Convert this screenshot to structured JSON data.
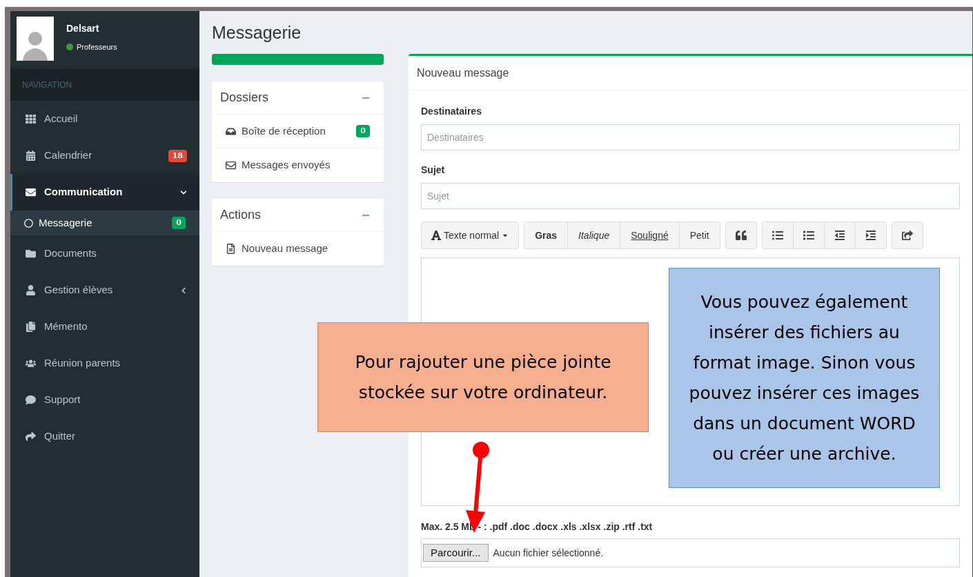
{
  "user": {
    "name": "Delsart",
    "role": "Professeurs",
    "online": true
  },
  "navigation": {
    "heading": "NAVIGATION",
    "items": [
      {
        "label": "Accueil",
        "kind": "grid",
        "selected": false
      },
      {
        "label": "Calendrier",
        "kind": "calendar",
        "selected": false,
        "badge": "18",
        "color": "#dd4b39"
      },
      {
        "label": "Communication",
        "kind": "envelope",
        "selected": true,
        "expanded": true,
        "children": [
          {
            "label": "Messagerie",
            "selected": true,
            "badge": "0",
            "color": "#00a65a"
          }
        ]
      },
      {
        "label": "Documents",
        "kind": "folder",
        "selected": false
      },
      {
        "label": "Gestion élèves",
        "kind": "user",
        "selected": false,
        "expanded": false
      },
      {
        "label": "Mémento",
        "kind": "copy",
        "selected": false
      },
      {
        "label": "Réunion parents",
        "kind": "users",
        "selected": false
      },
      {
        "label": "Support",
        "kind": "comment",
        "selected": false
      },
      {
        "label": "Quitter",
        "kind": "share",
        "selected": false
      }
    ]
  },
  "page_title": "Messagerie",
  "progress": {
    "level": 1
  },
  "folders": {
    "title": "Dossiers",
    "items": [
      {
        "label": "Boîte de réception",
        "kind": "inbox",
        "badge": "0",
        "color": "#00a65a"
      },
      {
        "label": "Messages envoyés",
        "kind": "envelope-outline"
      }
    ]
  },
  "actions": {
    "title": "Actions",
    "items": [
      {
        "label": "Nouveau message",
        "kind": "file"
      }
    ]
  },
  "compose": {
    "title": "Nouveau message",
    "fields": [
      {
        "label": "Destinataires",
        "placeholder": "Destinataires"
      },
      {
        "label": "Sujet",
        "placeholder": "Sujet"
      }
    ],
    "toolbar": [
      {
        "label": "Texte normal",
        "kind": "dropdown"
      },
      {
        "label": "Gras",
        "kind": "bold"
      },
      {
        "label": "Italique",
        "kind": "italic"
      },
      {
        "label": "Souligné",
        "kind": "underline"
      },
      {
        "label": "Petit",
        "kind": "small"
      }
    ],
    "attachment": {
      "hint": "Max. 2.5 Mb - : .pdf .doc .docx .xls .xlsx .zip .rtf .txt",
      "button": "Parcourir...",
      "status": "Aucun fichier sélectionné."
    }
  },
  "annotations": [
    {
      "kind": "orange",
      "text": "Pour rajouter une pièce jointe stockée sur votre ordinateur."
    },
    {
      "kind": "blue",
      "text": "Vous pouvez également insérer des fichiers au format image. Sinon vous pouvez insérer ces images dans un document WORD ou créer une archive."
    }
  ]
}
